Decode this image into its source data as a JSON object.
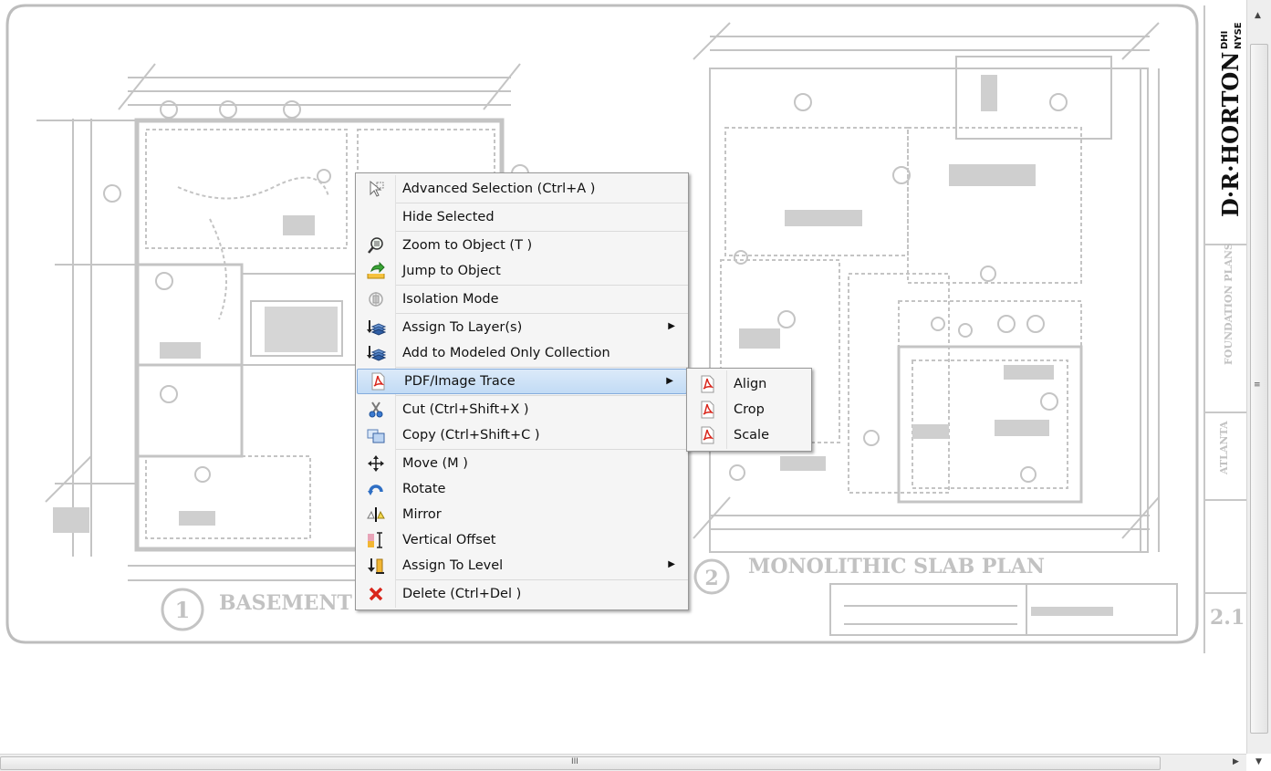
{
  "drawing": {
    "left_plan_label": "BASEMENT",
    "left_plan_number": "1",
    "right_plan_label": "MONOLITHIC SLAB PLAN",
    "right_plan_number": "2",
    "sheet_number": "2.1",
    "brand_logo": "D·R·HORTON",
    "brand_sub_top": "DHI",
    "brand_sub_bottom": "NYSE",
    "title_block_text": "FOUNDATION PLANS",
    "location_text": "ATLANTA"
  },
  "context_menu": {
    "items": [
      {
        "label": "Advanced Selection (Ctrl+A )",
        "icon": "pointer-select-icon",
        "submenu": false
      },
      {
        "label": "Hide Selected",
        "icon": "none",
        "submenu": false
      },
      {
        "label": "Zoom to Object (T )",
        "icon": "zoom-magnifier-icon",
        "submenu": false
      },
      {
        "label": "Jump to Object",
        "icon": "jump-arrow-icon",
        "submenu": false
      },
      {
        "label": "Isolation Mode",
        "icon": "isolation-icon",
        "submenu": false
      },
      {
        "label": "Assign To Layer(s)",
        "icon": "layers-icon",
        "submenu": true
      },
      {
        "label": "Add to Modeled Only Collection",
        "icon": "layers-add-icon",
        "submenu": false
      },
      {
        "label": "PDF/Image Trace",
        "icon": "pdf-icon",
        "submenu": true,
        "highlighted": true
      },
      {
        "label": "Cut (Ctrl+Shift+X )",
        "icon": "scissors-icon",
        "submenu": false
      },
      {
        "label": "Copy (Ctrl+Shift+C )",
        "icon": "copy-icon",
        "submenu": false
      },
      {
        "label": "Move (M )",
        "icon": "move-arrows-icon",
        "submenu": false
      },
      {
        "label": "Rotate",
        "icon": "rotate-icon",
        "submenu": false
      },
      {
        "label": "Mirror",
        "icon": "mirror-icon",
        "submenu": false
      },
      {
        "label": "Vertical Offset",
        "icon": "vertical-offset-icon",
        "submenu": false
      },
      {
        "label": "Assign To Level",
        "icon": "level-icon",
        "submenu": true
      },
      {
        "label": "Delete (Ctrl+Del )",
        "icon": "delete-x-icon",
        "submenu": false
      }
    ]
  },
  "submenu": {
    "items": [
      {
        "label": "Align",
        "icon": "pdf-icon"
      },
      {
        "label": "Crop",
        "icon": "pdf-icon"
      },
      {
        "label": "Scale",
        "icon": "pdf-icon"
      }
    ]
  },
  "scrollbars": {
    "vertical_grip": "≡",
    "horizontal_grip": "III"
  },
  "colors": {
    "menu_highlight": "#c2dbf5",
    "menu_highlight_border": "#84acdd",
    "drawing_lines": "#c4c4c4",
    "delete_red": "#d9261c"
  }
}
